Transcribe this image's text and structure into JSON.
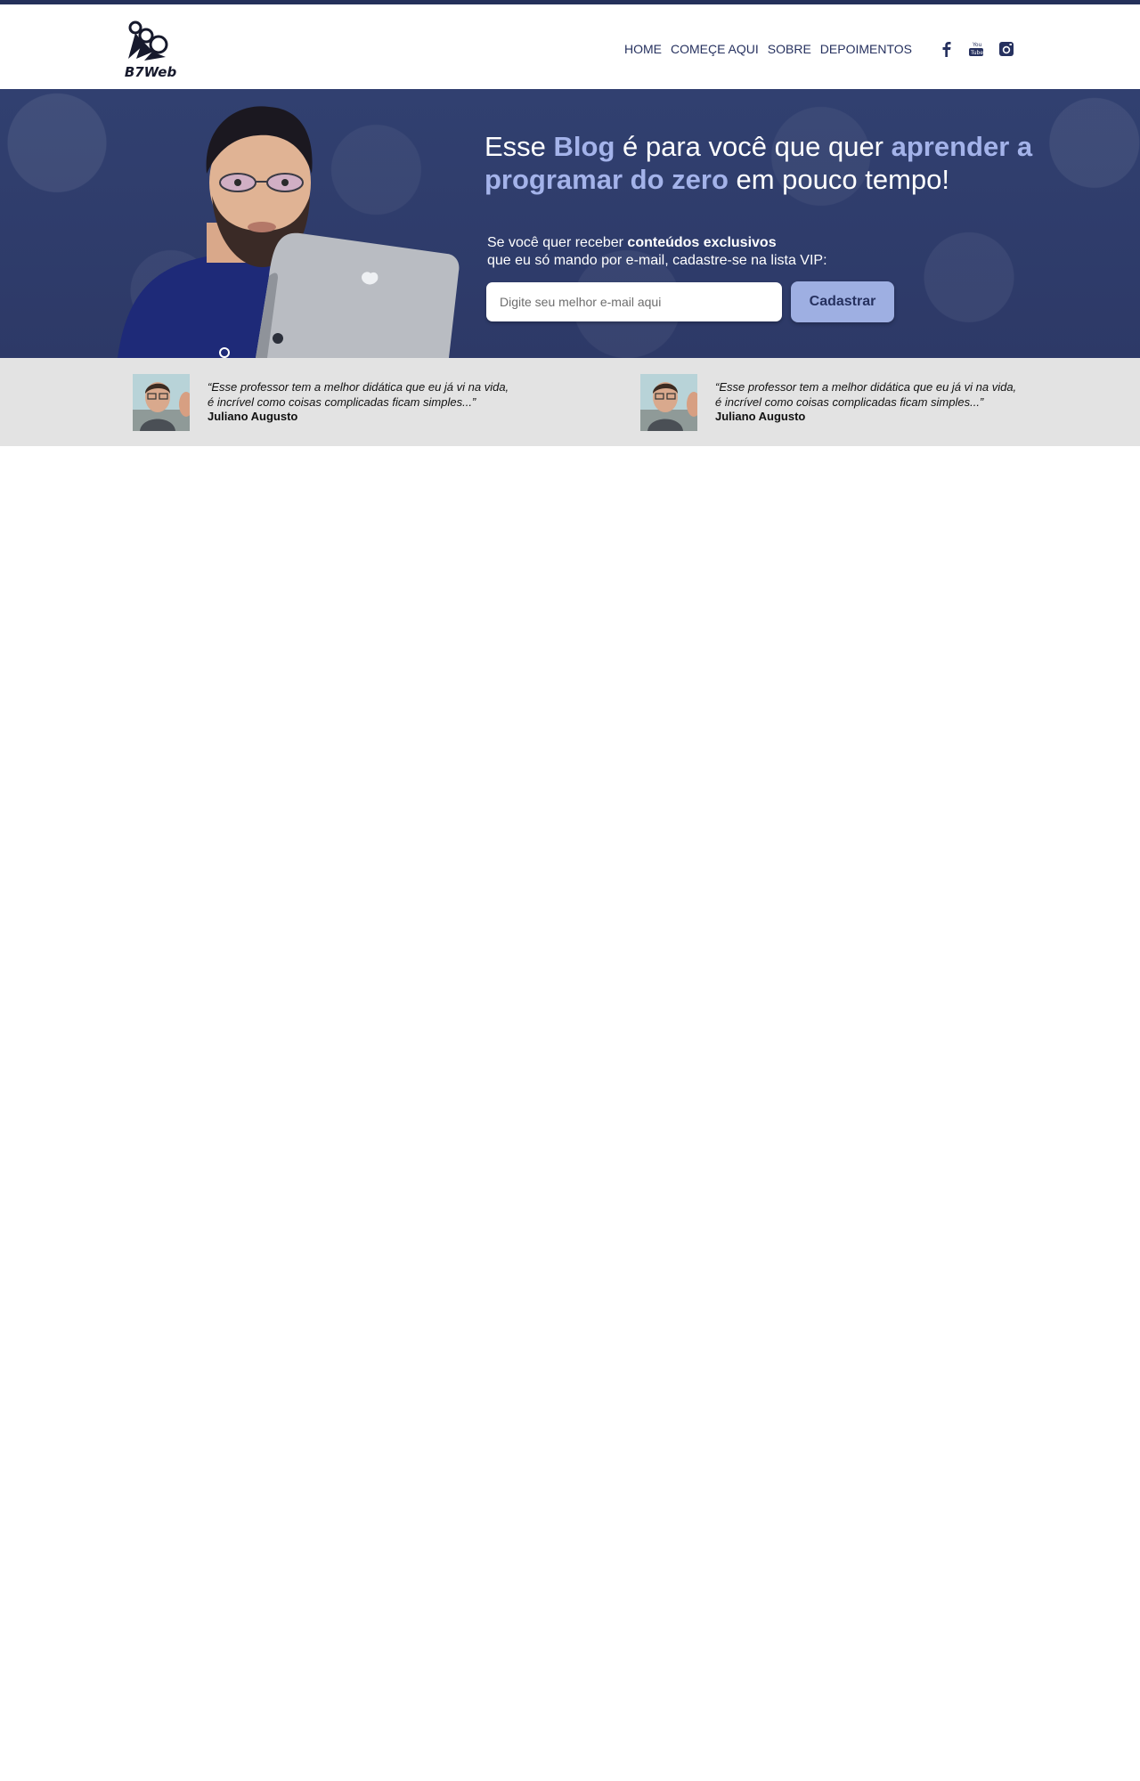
{
  "brand": {
    "logo_text": "B7Web"
  },
  "nav": {
    "items": [
      {
        "label": "HOME"
      },
      {
        "label": "COMEÇE AQUI"
      },
      {
        "label": "SOBRE"
      },
      {
        "label": "DEPOIMENTOS"
      }
    ],
    "social": [
      "facebook-icon",
      "youtube-icon",
      "instagram-icon"
    ]
  },
  "hero": {
    "headline_part1": "Esse ",
    "headline_highlight1": "Blog",
    "headline_part2": " é para você que quer ",
    "headline_highlight2": "aprender a programar do zero",
    "headline_part3": " em pouco tempo!",
    "subtext_part1": "Se você quer receber ",
    "subtext_bold": "conteúdos exclusivos",
    "subtext_part2": "que eu só mando por e-mail, cadastre-se na lista VIP:",
    "email_placeholder": "Digite seu melhor e-mail aqui",
    "button_label": "Cadastrar"
  },
  "testimonials": [
    {
      "quote_line1": "“Esse professor tem a melhor didática que eu já vi na vida,",
      "quote_line2": "é incrível como coisas complicadas ficam simples...”",
      "author": "Juliano Augusto"
    },
    {
      "quote_line1": "“Esse professor tem a melhor didática que eu já vi na vida,",
      "quote_line2": "é incrível como coisas complicadas ficam simples...”",
      "author": "Juliano Augusto"
    }
  ],
  "colors": {
    "primary": "#24305a",
    "accent": "#a4b3ea",
    "button": "#9eafe2",
    "testimonial_bg": "#e3e3e3"
  }
}
